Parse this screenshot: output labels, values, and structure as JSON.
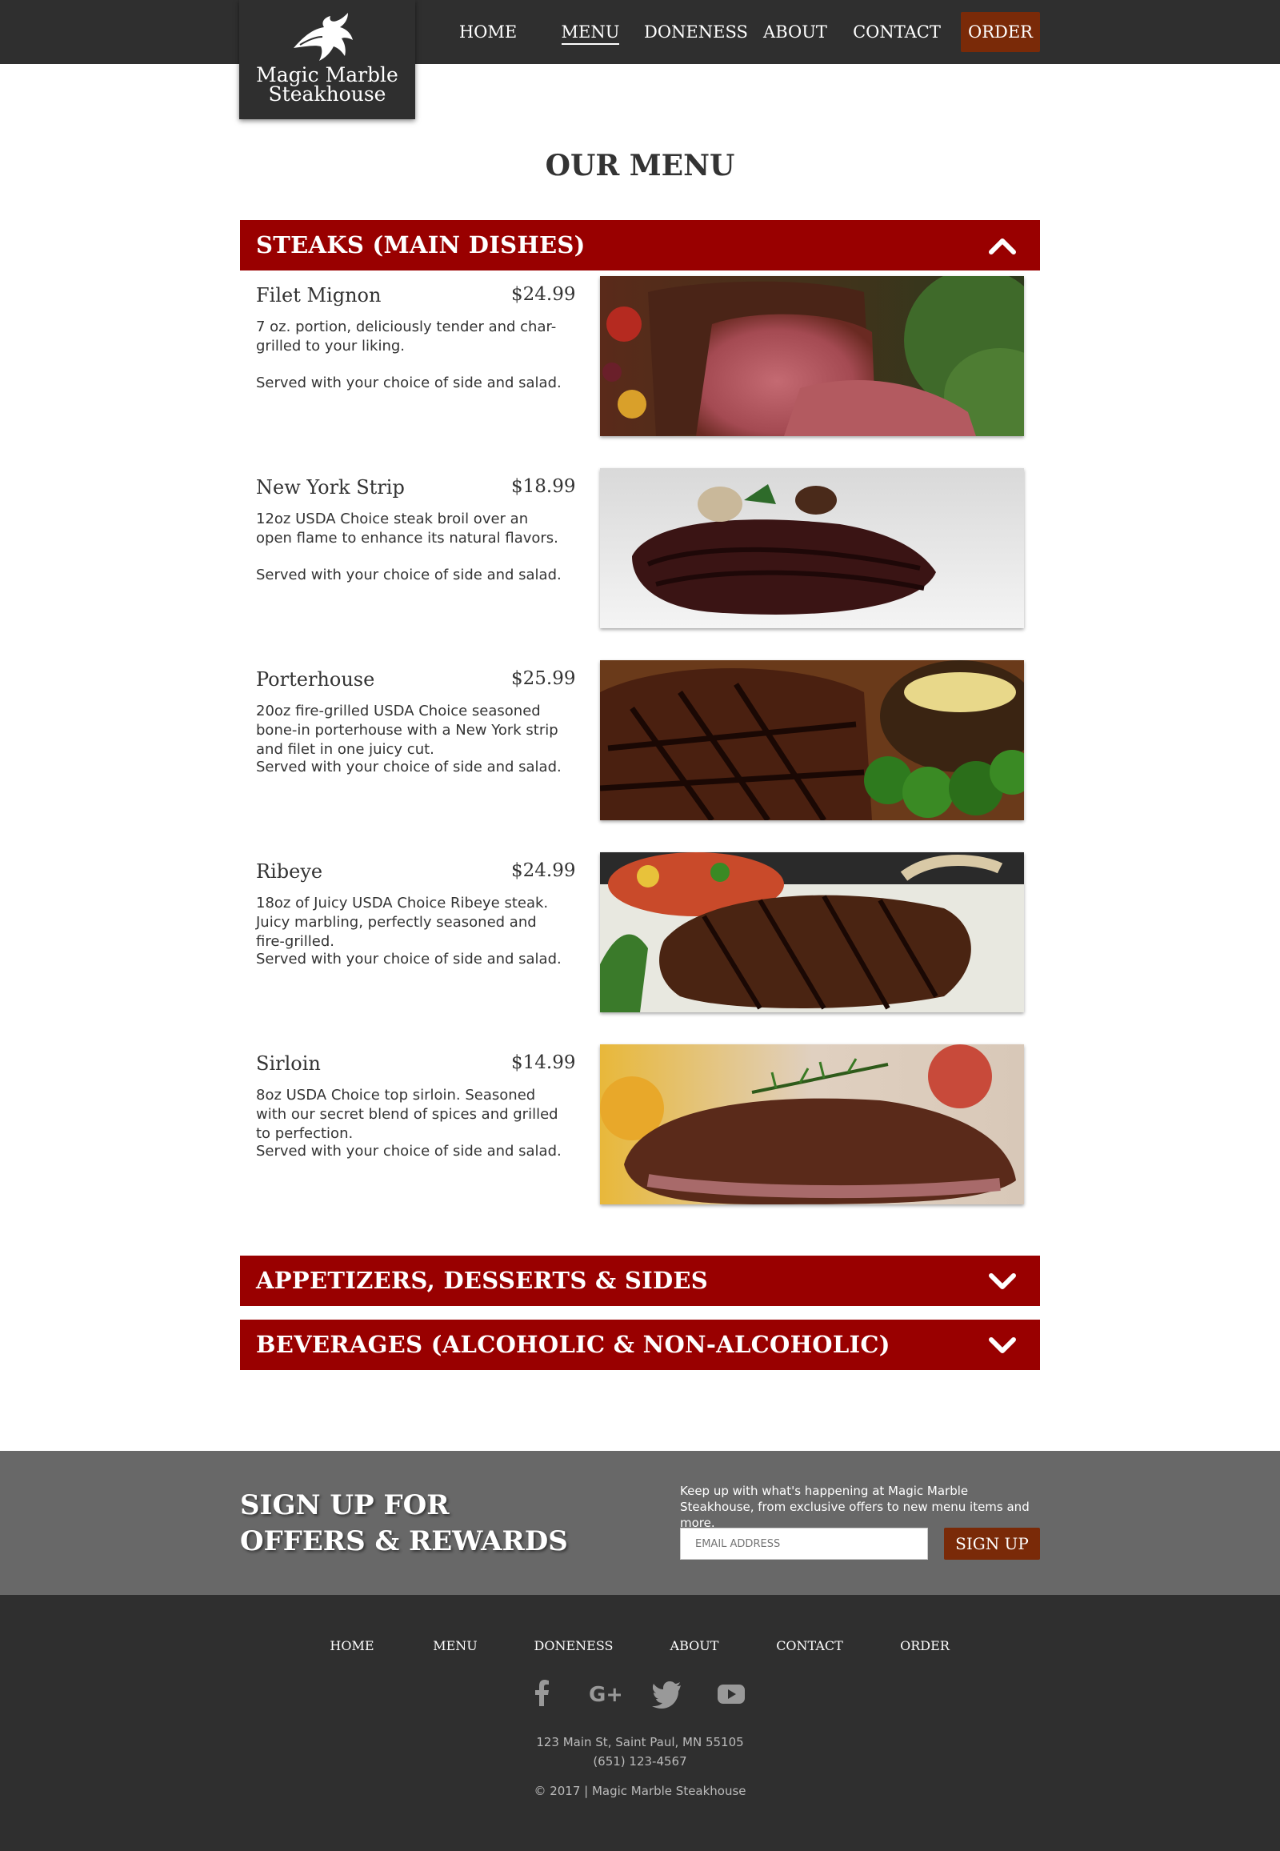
{
  "brand": {
    "line1": "Magic Marble",
    "line2": "Steakhouse"
  },
  "nav": {
    "home": "HOME",
    "menu": "MENU",
    "doneness": "DONENESS",
    "about": "ABOUT",
    "contact": "CONTACT",
    "order": "ORDER"
  },
  "page_title": "OUR MENU",
  "categories": [
    {
      "label": "STEAKS (MAIN DISHES)",
      "state": "expanded"
    },
    {
      "label": "APPETIZERS, DESSERTS & SIDES",
      "state": "collapsed"
    },
    {
      "label": "BEVERAGES (ALCOHOLIC & NON-ALCOHOLIC)",
      "state": "collapsed"
    }
  ],
  "steaks": [
    {
      "name": "Filet Mignon",
      "price": "$24.99",
      "desc": "7 oz. portion, deliciously tender and char-grilled to your liking.",
      "note": "Served with your choice of side and salad."
    },
    {
      "name": "New York Strip",
      "price": "$18.99",
      "desc": "12oz USDA Choice steak broil over an open flame to enhance its natural flavors.",
      "note": "Served with your choice of side and salad."
    },
    {
      "name": "Porterhouse",
      "price": "$25.99",
      "desc": "20oz fire-grilled USDA Choice seasoned bone-in porterhouse with a New York strip and filet in one juicy cut.",
      "note": "Served with your choice of side and salad."
    },
    {
      "name": "Ribeye",
      "price": "$24.99",
      "desc": "18oz of Juicy USDA Choice Ribeye steak. Juicy marbling, perfectly seasoned and fire-grilled.",
      "note": "Served with your choice of side and salad."
    },
    {
      "name": "Sirloin",
      "price": "$14.99",
      "desc": "8oz USDA Choice top sirloin. Seasoned with our secret blend of spices and grilled to perfection.",
      "note": "Served with your choice of side and salad."
    }
  ],
  "signup": {
    "title_line1": "SIGN UP FOR",
    "title_line2": "OFFERS & REWARDS",
    "blurb": "Keep up with what's happening at Magic Marble Steakhouse, from exclusive offers to new menu items and more.",
    "email_placeholder": "EMAIL ADDRESS",
    "button": "SIGN UP"
  },
  "footer": {
    "nav": [
      "HOME",
      "MENU",
      "DONENESS",
      "ABOUT",
      "CONTACT",
      "ORDER"
    ],
    "social_icons": [
      "facebook-icon",
      "google-plus-icon",
      "twitter-icon",
      "youtube-icon"
    ],
    "address": "123 Main St, Saint Paul, MN 55105",
    "phone": "(651) 123-4567",
    "copyright": "© 2017 | Magic Marble Steakhouse"
  },
  "colors": {
    "header": "#2f2f2f",
    "category_bar": "#990000",
    "order_button": "#7a2a08",
    "signup_band": "#686868"
  }
}
